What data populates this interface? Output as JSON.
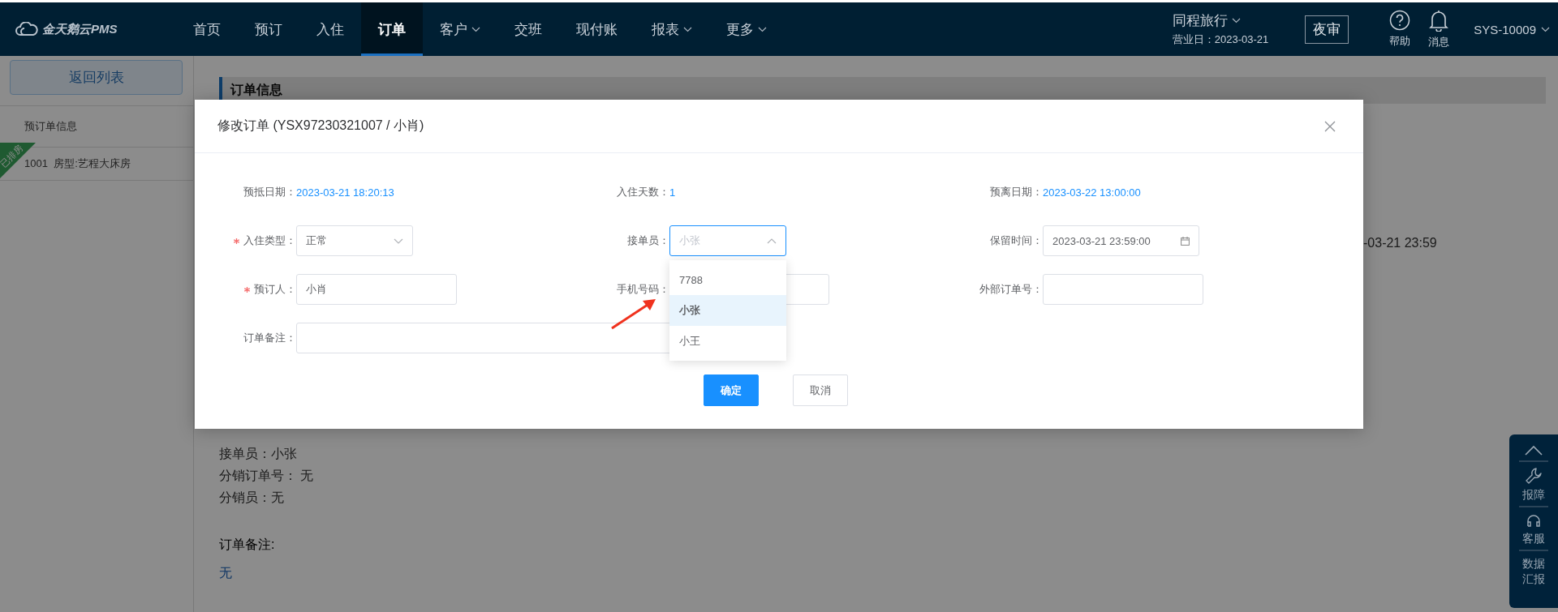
{
  "logo": {
    "text": "金天鹅云PMS"
  },
  "nav": [
    {
      "label": "首页",
      "selected": false,
      "dropdown": false
    },
    {
      "label": "预订",
      "selected": false,
      "dropdown": false
    },
    {
      "label": "入住",
      "selected": false,
      "dropdown": false
    },
    {
      "label": "订单",
      "selected": true,
      "dropdown": false
    },
    {
      "label": "客户",
      "selected": false,
      "dropdown": true
    },
    {
      "label": "交班",
      "selected": false,
      "dropdown": false
    },
    {
      "label": "现付账",
      "selected": false,
      "dropdown": false
    },
    {
      "label": "报表",
      "selected": false,
      "dropdown": true
    },
    {
      "label": "更多",
      "selected": false,
      "dropdown": true
    }
  ],
  "header_right": {
    "property": "同程旅行",
    "business_date": "营业日：2023-03-21",
    "night_audit": "夜审",
    "help": "帮助",
    "messages": "消息",
    "user": "SYS-10009"
  },
  "sidebar": {
    "back_button": "返回列表",
    "section": "预订单信息",
    "rooms": [
      {
        "badge": "已排房",
        "text": "1001  房型:艺程大床房"
      }
    ]
  },
  "main": {
    "section_title": "订单信息",
    "partial_value": "-03-21 23:59",
    "details": [
      "接单员：小张",
      "分销订单号： 无",
      "分销员：无"
    ],
    "remark_label": "订单备注:",
    "remark_value": "无"
  },
  "modal": {
    "title": "修改订单 (YSX97230321007 / 小肖)",
    "fields": [
      {
        "kind": "info",
        "label": "预抵日期：",
        "value": "2023-03-21 18:20:13"
      },
      {
        "kind": "info",
        "label": "入住天数：",
        "value": "1"
      },
      {
        "kind": "info",
        "label": "预离日期：",
        "value": "2023-03-22 13:00:00"
      },
      {
        "kind": "select",
        "label": "入住类型：",
        "required": true,
        "value": "正常",
        "open": false
      },
      {
        "kind": "select",
        "label": "接单员：",
        "required": false,
        "placeholder": "小张",
        "open": true,
        "options": [
          {
            "label": "7788",
            "selected": false
          },
          {
            "label": "小张",
            "selected": true
          },
          {
            "label": "小王",
            "selected": false
          }
        ]
      },
      {
        "kind": "date",
        "label": "保留时间：",
        "required": false,
        "value": "2023-03-21 23:59:00"
      },
      {
        "kind": "text",
        "label": "预订人：",
        "required": true,
        "value": "小肖"
      },
      {
        "kind": "phone",
        "label": "手机号码：",
        "required": false
      },
      {
        "kind": "text",
        "label": "外部订单号：",
        "required": false
      },
      {
        "kind": "wide",
        "label": "订单备注：",
        "required": false
      }
    ],
    "buttons": [
      {
        "label": "确定",
        "kind": "primary"
      },
      {
        "label": "取消",
        "kind": "default"
      }
    ]
  },
  "float_panel": [
    {
      "kind": "top"
    },
    {
      "kind": "wrench",
      "label": "报障"
    },
    {
      "kind": "headset",
      "label": "客服"
    },
    {
      "kind": "text",
      "label": "数据汇报"
    }
  ]
}
